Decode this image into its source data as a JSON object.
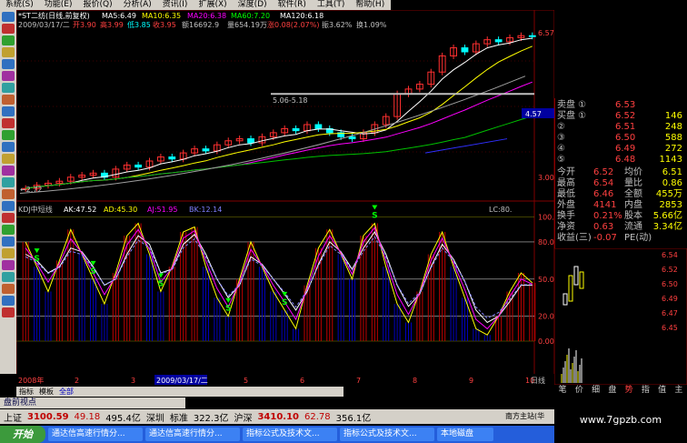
{
  "menu": [
    "系统(S)",
    "功能(E)",
    "报价(Q)",
    "分析(A)",
    "资讯(I)",
    "扩展(X)",
    "深度(D)",
    "软件(R)",
    "工具(T)",
    "帮助(H)"
  ],
  "header": {
    "title": "*ST二纺(日线,前复权)",
    "ma5": "MA5:6.49",
    "ma10": "MA10:6.35",
    "ma20": "MA20:6.38",
    "ma60": "MA60:7.20",
    "ma120": "MA120:6.18",
    "info_date": "2009/03/17/二",
    "info_open": "开3.90",
    "info_high": "高3.99",
    "info_low": "低3.85",
    "info_close": "收3.95",
    "info_amount": "额16692.9",
    "info_volume": "量654.19万",
    "info_change": "涨0.08(2.07%)",
    "info_amp": "振3.62%",
    "info_turn": "换1.09%"
  },
  "price_axis": [
    "6.57",
    "4.57",
    "3.00"
  ],
  "annotations": {
    "range": "5.06-5.18",
    "low": "2.72",
    "current": "4.57"
  },
  "kdj": {
    "title": "KDJ中短线",
    "ak": "AK:47.52",
    "ad": "AD:45.30",
    "aj": "AJ:51.95",
    "bk": "BK:12.14",
    "lc": "LC:80.",
    "axis": [
      "100.0",
      "80.0",
      "50.0",
      "20.0",
      "0.00"
    ],
    "signals": [
      "S",
      "S",
      "S",
      "S",
      "S",
      "S"
    ]
  },
  "date_axis": {
    "start": "2008年",
    "labels": [
      "2",
      "3",
      "4",
      "5",
      "6",
      "7",
      "8",
      "9",
      "10"
    ],
    "cursor": "2009/03/17/二",
    "end": "日线"
  },
  "left_tabs": [
    "指标",
    "模板",
    "全部"
  ],
  "quote_panel": {
    "rows": [
      {
        "l": "卖盘",
        "m": "①",
        "p": "6.53",
        "v": "",
        "pc": "#ff4040",
        "vc": "#ffff00"
      },
      {
        "l": "买盘",
        "m": "①",
        "p": "6.52",
        "v": "146",
        "pc": "#ff4040",
        "vc": "#ffff00"
      },
      {
        "l": "",
        "m": "②",
        "p": "6.51",
        "v": "248",
        "pc": "#ff4040",
        "vc": "#ffff00"
      },
      {
        "l": "",
        "m": "③",
        "p": "6.50",
        "v": "588",
        "pc": "#ff4040",
        "vc": "#ffff00"
      },
      {
        "l": "",
        "m": "④",
        "p": "6.49",
        "v": "272",
        "pc": "#ff4040",
        "vc": "#ffff00"
      },
      {
        "l": "",
        "m": "⑤",
        "p": "6.48",
        "v": "1143",
        "pc": "#ff4040",
        "vc": "#ffff00"
      }
    ],
    "stats": [
      {
        "a": "今开",
        "b": "6.52",
        "c": "均价",
        "d": "6.51"
      },
      {
        "a": "最高",
        "b": "6.54",
        "c": "量比",
        "d": "0.86"
      },
      {
        "a": "最低",
        "b": "6.46",
        "c": "全额",
        "d": "455万"
      },
      {
        "a": "外盘",
        "b": "4141",
        "c": "内盘",
        "d": "2853"
      },
      {
        "a": "换手",
        "b": "0.21%",
        "c": "股本",
        "d": "5.66亿"
      },
      {
        "a": "净资",
        "b": "0.63",
        "c": "流通",
        "d": "3.34亿"
      },
      {
        "a": "收益(三)",
        "b": "-0.07",
        "c": "PE(动)",
        "d": ""
      }
    ]
  },
  "mini_axis": [
    "6.54",
    "6.52",
    "6.50",
    "6.49",
    "6.47",
    "6.45"
  ],
  "right_tabs": [
    "笔",
    "价",
    "细",
    "盘",
    "势",
    "指",
    "值",
    "主"
  ],
  "quote_label": "盘前视点",
  "index_bar": {
    "sh": "上证",
    "sh_val": "3100.59",
    "sh_chg": "49.18",
    "sh_amt": "495.4亿",
    "mid": "深圳",
    "mid2": "标准",
    "amt2": "322.3亿",
    "hs": "沪深",
    "hs_val": "3410.10",
    "hs_chg": "62.78",
    "hs_amt": "356.1亿",
    "brand": "南方主站(华"
  },
  "taskbar": {
    "start": "开始",
    "tasks": [
      "通达信高速行情分...",
      "通达信高速行情分...",
      "指标公式及技术文...",
      "指标公式及技术文...",
      "本地磁盘"
    ]
  },
  "watermark": "www.7gpzb.com",
  "colors": {
    "up": "#ff3030",
    "down": "#00ffff",
    "ma_yellow": "#ffff00",
    "ma_white": "#ffffff",
    "ma_green": "#00c000",
    "ma_magenta": "#ff00ff"
  },
  "chart_data": {
    "type": "candlestick",
    "title": "*ST二纺(日线,前复权)",
    "price_series": [
      2.72,
      2.8,
      2.85,
      2.9,
      3.0,
      3.05,
      3.1,
      3.0,
      3.2,
      3.3,
      3.25,
      3.4,
      3.5,
      3.45,
      3.6,
      3.7,
      3.65,
      3.8,
      3.9,
      3.95,
      3.85,
      4.0,
      4.1,
      4.2,
      4.15,
      4.3,
      4.2,
      4.1,
      4.0,
      3.95,
      4.1,
      4.3,
      4.5,
      5.06,
      5.18,
      5.3,
      5.6,
      6.0,
      6.2,
      6.1,
      6.3,
      6.4,
      6.35,
      6.45,
      6.5,
      6.49
    ],
    "kdj_k": [
      80,
      60,
      40,
      65,
      90,
      70,
      50,
      30,
      55,
      85,
      95,
      70,
      40,
      60,
      88,
      92,
      60,
      35,
      20,
      50,
      80,
      60,
      40,
      25,
      10,
      45,
      75,
      90,
      70,
      50,
      85,
      95,
      60,
      30,
      15,
      40,
      70,
      88,
      60,
      35,
      10,
      5,
      20,
      40,
      55,
      47
    ],
    "kdj_d": [
      70,
      65,
      55,
      60,
      75,
      72,
      60,
      45,
      50,
      70,
      85,
      78,
      55,
      58,
      78,
      86,
      70,
      50,
      35,
      45,
      68,
      62,
      50,
      38,
      25,
      40,
      62,
      80,
      72,
      58,
      75,
      88,
      70,
      45,
      28,
      38,
      60,
      78,
      66,
      48,
      25,
      15,
      20,
      32,
      45,
      45
    ],
    "ylim_price": [
      2.5,
      7.0
    ],
    "ylim_kdj": [
      0,
      110
    ]
  }
}
